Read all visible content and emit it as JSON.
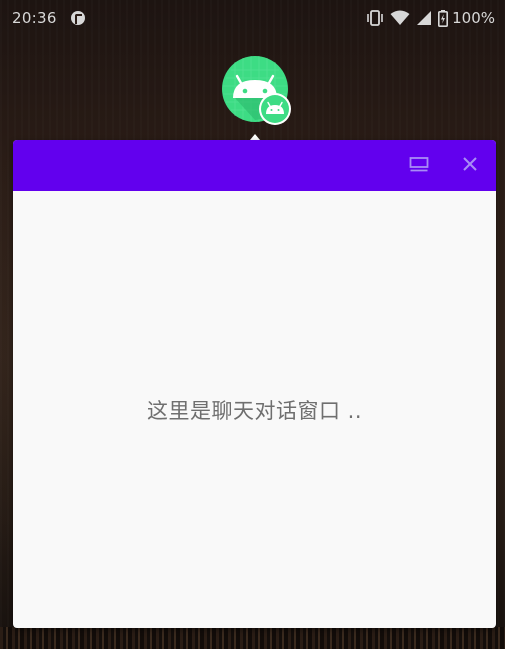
{
  "status_bar": {
    "time": "20:36",
    "battery_percent": "100%",
    "icons": [
      "notification-app-icon",
      "vibrate-icon",
      "wifi-icon",
      "cellular-signal-icon",
      "battery-charging-icon"
    ]
  },
  "bubble": {
    "icon": "android-bubble-icon",
    "accent_color": "#3ddc84"
  },
  "chat_window": {
    "header_color": "#6200ee",
    "minimize_icon": "minimize-window-icon",
    "close_icon": "close-icon",
    "placeholder_text": "这里是聊天对话窗口 .."
  }
}
